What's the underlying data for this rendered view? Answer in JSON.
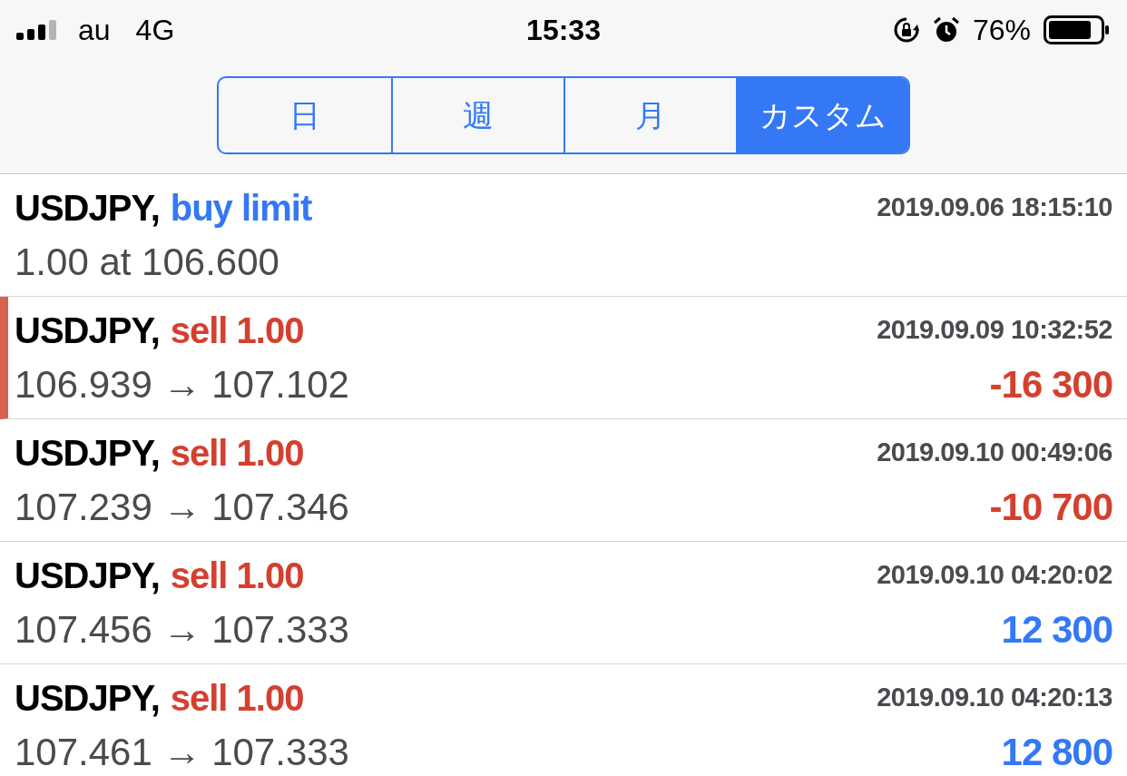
{
  "status_bar": {
    "carrier": "au",
    "network": "4G",
    "time": "15:33",
    "battery": "76%"
  },
  "tabs": [
    {
      "label": "日",
      "selected": false
    },
    {
      "label": "週",
      "selected": false
    },
    {
      "label": "月",
      "selected": false
    },
    {
      "label": "カスタム",
      "selected": true
    }
  ],
  "rows": [
    {
      "symbol": "USDJPY,",
      "action": {
        "text": "buy limit",
        "color": "#3478f6"
      },
      "time": "2019.09.06 18:15:10",
      "detail": "1.00 at 106.600",
      "marked": false
    },
    {
      "symbol": "USDJPY,",
      "action": {
        "text": "sell 1.00",
        "color": "#d4402f"
      },
      "time": "2019.09.09 10:32:52",
      "detail": "106.939 → 107.102",
      "profit": {
        "text": "-16 300",
        "color": "#d4402f"
      },
      "marked": true
    },
    {
      "symbol": "USDJPY,",
      "action": {
        "text": "sell 1.00",
        "color": "#d4402f"
      },
      "time": "2019.09.10 00:49:06",
      "detail": "107.239 → 107.346",
      "profit": {
        "text": "-10 700",
        "color": "#d4402f"
      },
      "marked": false
    },
    {
      "symbol": "USDJPY,",
      "action": {
        "text": "sell 1.00",
        "color": "#d4402f"
      },
      "time": "2019.09.10 04:20:02",
      "detail": "107.456 → 107.333",
      "profit": {
        "text": "12 300",
        "color": "#3478f6"
      },
      "marked": false
    },
    {
      "symbol": "USDJPY,",
      "action": {
        "text": "sell 1.00",
        "color": "#d4402f"
      },
      "time": "2019.09.10 04:20:13",
      "detail": "107.461 → 107.333",
      "profit": {
        "text": "12 800",
        "color": "#3478f6"
      },
      "marked": false
    }
  ]
}
